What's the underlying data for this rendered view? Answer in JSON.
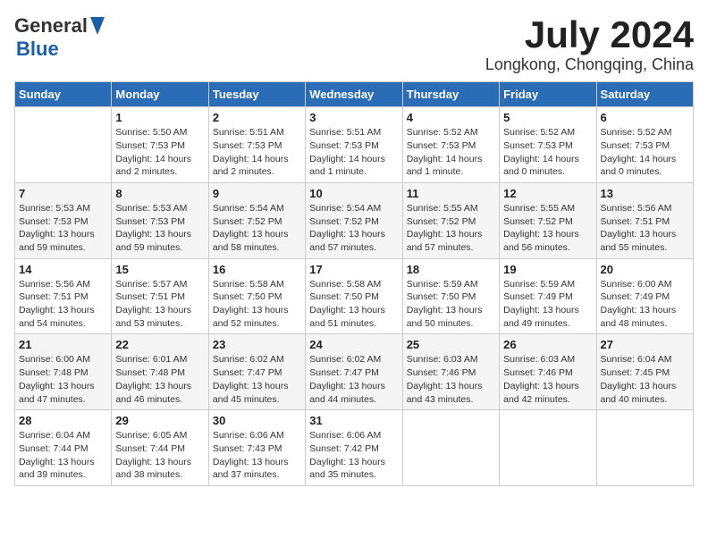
{
  "header": {
    "logo_line1": "General",
    "logo_line2": "Blue",
    "month_title": "July 2024",
    "location": "Longkong, Chongqing, China"
  },
  "days_of_week": [
    "Sunday",
    "Monday",
    "Tuesday",
    "Wednesday",
    "Thursday",
    "Friday",
    "Saturday"
  ],
  "weeks": [
    [
      {
        "day": "",
        "info": ""
      },
      {
        "day": "1",
        "info": "Sunrise: 5:50 AM\nSunset: 7:53 PM\nDaylight: 14 hours\nand 2 minutes."
      },
      {
        "day": "2",
        "info": "Sunrise: 5:51 AM\nSunset: 7:53 PM\nDaylight: 14 hours\nand 2 minutes."
      },
      {
        "day": "3",
        "info": "Sunrise: 5:51 AM\nSunset: 7:53 PM\nDaylight: 14 hours\nand 1 minute."
      },
      {
        "day": "4",
        "info": "Sunrise: 5:52 AM\nSunset: 7:53 PM\nDaylight: 14 hours\nand 1 minute."
      },
      {
        "day": "5",
        "info": "Sunrise: 5:52 AM\nSunset: 7:53 PM\nDaylight: 14 hours\nand 0 minutes."
      },
      {
        "day": "6",
        "info": "Sunrise: 5:52 AM\nSunset: 7:53 PM\nDaylight: 14 hours\nand 0 minutes."
      }
    ],
    [
      {
        "day": "7",
        "info": "Sunrise: 5:53 AM\nSunset: 7:53 PM\nDaylight: 13 hours\nand 59 minutes."
      },
      {
        "day": "8",
        "info": "Sunrise: 5:53 AM\nSunset: 7:53 PM\nDaylight: 13 hours\nand 59 minutes."
      },
      {
        "day": "9",
        "info": "Sunrise: 5:54 AM\nSunset: 7:52 PM\nDaylight: 13 hours\nand 58 minutes."
      },
      {
        "day": "10",
        "info": "Sunrise: 5:54 AM\nSunset: 7:52 PM\nDaylight: 13 hours\nand 57 minutes."
      },
      {
        "day": "11",
        "info": "Sunrise: 5:55 AM\nSunset: 7:52 PM\nDaylight: 13 hours\nand 57 minutes."
      },
      {
        "day": "12",
        "info": "Sunrise: 5:55 AM\nSunset: 7:52 PM\nDaylight: 13 hours\nand 56 minutes."
      },
      {
        "day": "13",
        "info": "Sunrise: 5:56 AM\nSunset: 7:51 PM\nDaylight: 13 hours\nand 55 minutes."
      }
    ],
    [
      {
        "day": "14",
        "info": "Sunrise: 5:56 AM\nSunset: 7:51 PM\nDaylight: 13 hours\nand 54 minutes."
      },
      {
        "day": "15",
        "info": "Sunrise: 5:57 AM\nSunset: 7:51 PM\nDaylight: 13 hours\nand 53 minutes."
      },
      {
        "day": "16",
        "info": "Sunrise: 5:58 AM\nSunset: 7:50 PM\nDaylight: 13 hours\nand 52 minutes."
      },
      {
        "day": "17",
        "info": "Sunrise: 5:58 AM\nSunset: 7:50 PM\nDaylight: 13 hours\nand 51 minutes."
      },
      {
        "day": "18",
        "info": "Sunrise: 5:59 AM\nSunset: 7:50 PM\nDaylight: 13 hours\nand 50 minutes."
      },
      {
        "day": "19",
        "info": "Sunrise: 5:59 AM\nSunset: 7:49 PM\nDaylight: 13 hours\nand 49 minutes."
      },
      {
        "day": "20",
        "info": "Sunrise: 6:00 AM\nSunset: 7:49 PM\nDaylight: 13 hours\nand 48 minutes."
      }
    ],
    [
      {
        "day": "21",
        "info": "Sunrise: 6:00 AM\nSunset: 7:48 PM\nDaylight: 13 hours\nand 47 minutes."
      },
      {
        "day": "22",
        "info": "Sunrise: 6:01 AM\nSunset: 7:48 PM\nDaylight: 13 hours\nand 46 minutes."
      },
      {
        "day": "23",
        "info": "Sunrise: 6:02 AM\nSunset: 7:47 PM\nDaylight: 13 hours\nand 45 minutes."
      },
      {
        "day": "24",
        "info": "Sunrise: 6:02 AM\nSunset: 7:47 PM\nDaylight: 13 hours\nand 44 minutes."
      },
      {
        "day": "25",
        "info": "Sunrise: 6:03 AM\nSunset: 7:46 PM\nDaylight: 13 hours\nand 43 minutes."
      },
      {
        "day": "26",
        "info": "Sunrise: 6:03 AM\nSunset: 7:46 PM\nDaylight: 13 hours\nand 42 minutes."
      },
      {
        "day": "27",
        "info": "Sunrise: 6:04 AM\nSunset: 7:45 PM\nDaylight: 13 hours\nand 40 minutes."
      }
    ],
    [
      {
        "day": "28",
        "info": "Sunrise: 6:04 AM\nSunset: 7:44 PM\nDaylight: 13 hours\nand 39 minutes."
      },
      {
        "day": "29",
        "info": "Sunrise: 6:05 AM\nSunset: 7:44 PM\nDaylight: 13 hours\nand 38 minutes."
      },
      {
        "day": "30",
        "info": "Sunrise: 6:06 AM\nSunset: 7:43 PM\nDaylight: 13 hours\nand 37 minutes."
      },
      {
        "day": "31",
        "info": "Sunrise: 6:06 AM\nSunset: 7:42 PM\nDaylight: 13 hours\nand 35 minutes."
      },
      {
        "day": "",
        "info": ""
      },
      {
        "day": "",
        "info": ""
      },
      {
        "day": "",
        "info": ""
      }
    ]
  ]
}
